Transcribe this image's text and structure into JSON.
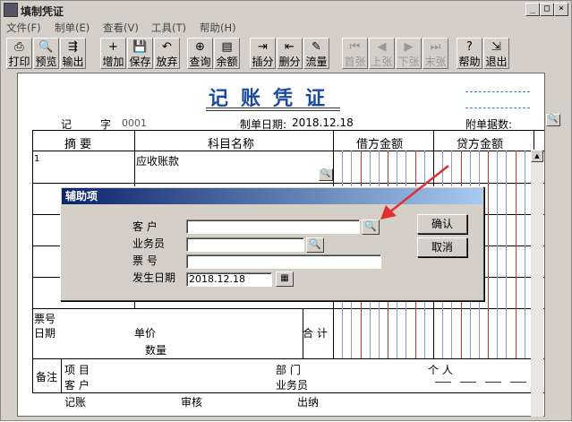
{
  "window": {
    "title": "填制凭证",
    "min": "_",
    "max": "□",
    "close": "×"
  },
  "menu": [
    "文件(F)",
    "制单(E)",
    "查看(V)",
    "工具(T)",
    "帮助(H)"
  ],
  "toolbar": [
    {
      "label": "打印",
      "icon": "print-icon",
      "glyph": "⎙",
      "enabled": true
    },
    {
      "label": "预览",
      "icon": "preview-icon",
      "glyph": "🔍",
      "enabled": true
    },
    {
      "label": "输出",
      "icon": "export-icon",
      "glyph": "⇶",
      "enabled": true
    },
    {
      "label": "增加",
      "icon": "add-icon",
      "glyph": "+",
      "enabled": true
    },
    {
      "label": "保存",
      "icon": "save-icon",
      "glyph": "💾",
      "enabled": true
    },
    {
      "label": "放弃",
      "icon": "discard-icon",
      "glyph": "↶",
      "enabled": true
    },
    {
      "label": "查询",
      "icon": "query-icon",
      "glyph": "⊕",
      "enabled": true
    },
    {
      "label": "余额",
      "icon": "balance-icon",
      "glyph": "▤",
      "enabled": true
    },
    {
      "label": "插分",
      "icon": "insert-row-icon",
      "glyph": "⇥",
      "enabled": true
    },
    {
      "label": "删分",
      "icon": "delete-row-icon",
      "glyph": "⇤",
      "enabled": true
    },
    {
      "label": "流量",
      "icon": "cashflow-icon",
      "glyph": "✎",
      "enabled": true
    },
    {
      "label": "首张",
      "icon": "first-icon",
      "glyph": "⏮",
      "enabled": false
    },
    {
      "label": "上张",
      "icon": "prev-icon",
      "glyph": "◀",
      "enabled": false
    },
    {
      "label": "下张",
      "icon": "next-icon",
      "glyph": "▶",
      "enabled": false
    },
    {
      "label": "末张",
      "icon": "last-icon",
      "glyph": "⏭",
      "enabled": false
    },
    {
      "label": "帮助",
      "icon": "help-icon",
      "glyph": "?",
      "enabled": true
    },
    {
      "label": "退出",
      "icon": "exit-icon",
      "glyph": "⇲",
      "enabled": true
    }
  ],
  "voucher": {
    "title": "记账凭证",
    "type_label": "记",
    "number_label": "字",
    "number": "0001",
    "date_label": "制单日期:",
    "date": "2018.12.18",
    "attach_label": "附单据数:",
    "col_summary": "摘 要",
    "col_account": "科目名称",
    "col_debit": "借方金额",
    "col_credit": "贷方金额",
    "row1_index": "1",
    "row1_account": "应收账款",
    "bill_no": "票号",
    "bill_date": "日期",
    "unit_price": "单价",
    "quantity": "数量",
    "total": "合 计",
    "remark": "备注",
    "project": "项 目",
    "customer": "客 户",
    "dept": "部 门",
    "salesman": "业务员",
    "person": "个 人",
    "bookkeeper": "记账",
    "auditor": "审核",
    "cashier": "出纳"
  },
  "dialog": {
    "title": "辅助项",
    "customer_label": "客 户",
    "salesman_label": "业务员",
    "bill_label": "票 号",
    "date_label": "发生日期",
    "date_value": "2018.12.18",
    "ok": "确认",
    "cancel": "取消"
  },
  "colors": {
    "title_blue": "#1a4aa0",
    "arrow_red": "#e03030",
    "dialog_title": "#0a246a"
  }
}
